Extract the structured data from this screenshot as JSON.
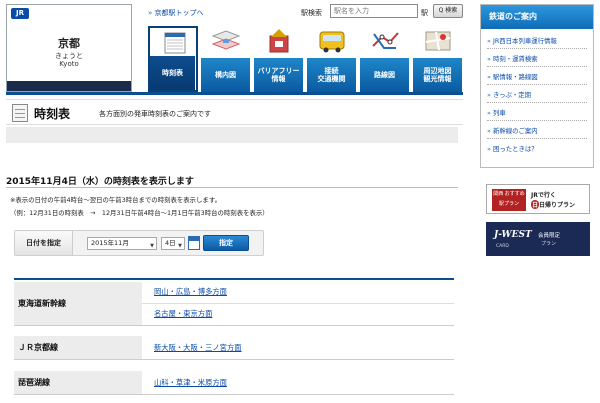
{
  "station": {
    "name_kanji": "京都",
    "name_kana": "きょうと",
    "name_roman": "Kyoto",
    "logo": "JR"
  },
  "top_link": {
    "arrow": "»",
    "label": "京都駅トップへ"
  },
  "search": {
    "label": "駅検索",
    "placeholder": "駅名を入力",
    "suffix": "駅",
    "button": "Q 検索"
  },
  "tabs": [
    {
      "label": "時刻表",
      "icon": "timetable-icon",
      "active": true
    },
    {
      "label": "構内図",
      "icon": "floor-map-icon",
      "active": false
    },
    {
      "label": "バリアフリー\n情報",
      "icon": "barrier-free-icon",
      "active": false
    },
    {
      "label": "接続\n交通機関",
      "icon": "bus-icon",
      "active": false
    },
    {
      "label": "路線図",
      "icon": "route-map-icon",
      "active": false
    },
    {
      "label": "周辺地図\n観光情報",
      "icon": "area-map-icon",
      "active": false
    }
  ],
  "page": {
    "title": "時刻表",
    "description": "各方面別の発車時刻表のご案内です"
  },
  "date_heading": "2015年11月4日（水）の時刻表を表示します",
  "notes": {
    "line1": "※表示の日付の午前4時台～翌日の午前3時台までの時刻表を表示します。",
    "line2": "（例：12月31日の時刻表　→　12月31日午前4時台～1月1日午前3時台の時刻表を表示）"
  },
  "date_selector": {
    "label": "日付を指定",
    "year_month": "2015年11月",
    "day": "4日",
    "button": "指定"
  },
  "lines": [
    {
      "name": "東海道新幹線",
      "directions": [
        "岡山・広島・博多方面",
        "名古屋・東京方面"
      ]
    },
    {
      "name": "ＪＲ京都線",
      "directions": [
        "新大阪・大阪・三ノ宮方面"
      ]
    },
    {
      "name": "琵琶湖線",
      "directions": [
        "山科・草津・米原方面"
      ]
    }
  ],
  "sidebar": {
    "title": "鉄道のご案内",
    "items": [
      "JR西日本列車運行情報",
      "時刻・運賃検索",
      "駅情報・路線図",
      "きっぷ・定期",
      "列車",
      "新幹線のご案内",
      "困ったときは？"
    ]
  },
  "banners": {
    "eki_plan_tag": "関西 おすすめ\n駅プラン",
    "eki_plan_line1": "JRで行く",
    "eki_plan_line2": "日帰りプラン",
    "eki_plan_badge": "日",
    "jwest_logo": "J-WEST",
    "jwest_card": "CARD",
    "jwest_line1": "会員限定",
    "jwest_line2": "プラン"
  },
  "colors": {
    "brand_blue": "#0b5aa0",
    "link": "#0a4aa8",
    "banner_red": "#b22222",
    "jwest_navy": "#1a2a55"
  }
}
